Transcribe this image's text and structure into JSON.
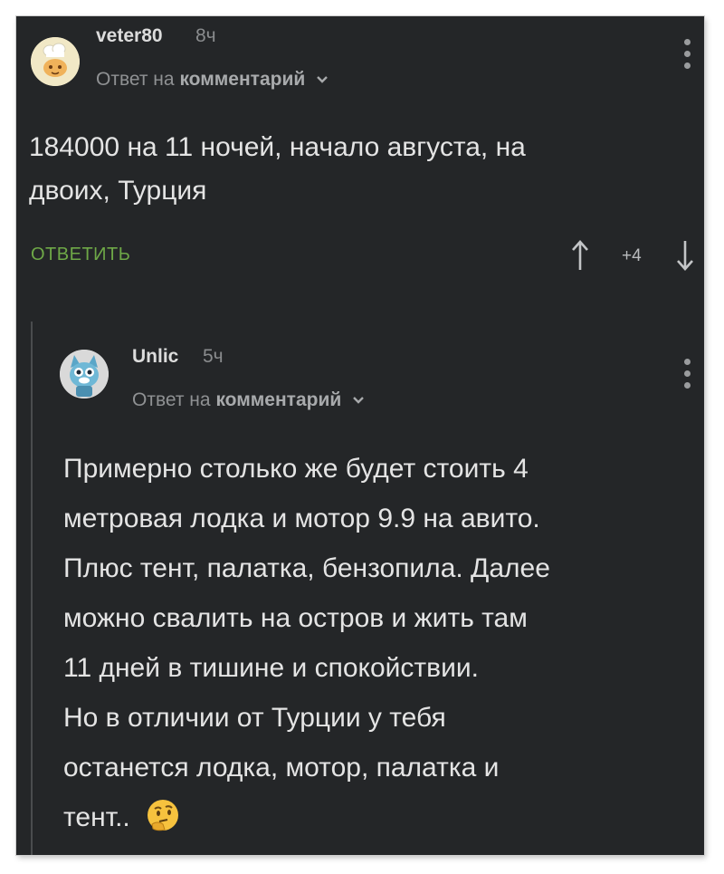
{
  "comment1": {
    "username": "veter80",
    "time": "8ч",
    "reply_prefix": "Ответ на",
    "reply_target": "комментарий",
    "text_lines": [
      "184000 на 11 ночей, начало августа, на",
      "двоих, Турция"
    ],
    "reply_button": "ОТВЕТИТЬ",
    "rating": "+4"
  },
  "comment2": {
    "username": "Unlic",
    "time": "5ч",
    "reply_prefix": "Ответ на",
    "reply_target": "комментарий",
    "text_lines": [
      "Примерно столько же будет стоить 4",
      "метровая лодка и мотор 9.9 на авито.",
      "Плюс тент, палатка, бензопила. Далее",
      "можно свалить на остров и жить там",
      "11 дней в тишине и спокойствии.",
      "Но в отличии от Турции у тебя",
      "останется лодка, мотор, палатка и",
      "тент.."
    ]
  },
  "colors": {
    "background": "#242628",
    "accent": "#6ea847",
    "text": "#e4e4e4",
    "muted": "#8f9193"
  },
  "icons": [
    "chef-avatar-icon",
    "cat-avatar-icon",
    "chevron-down-icon",
    "more-vertical-icon",
    "arrow-up-icon",
    "arrow-down-icon",
    "thinking-face-emoji"
  ]
}
